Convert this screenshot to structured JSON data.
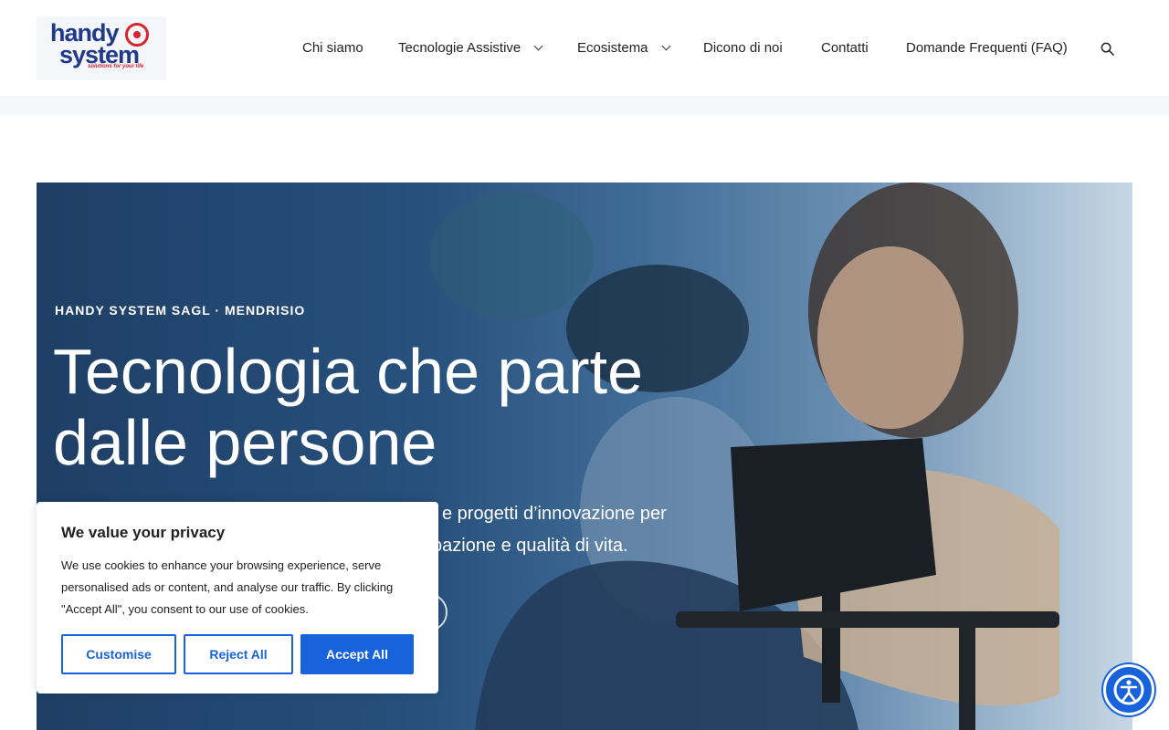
{
  "header": {
    "logo": {
      "line1": "handy",
      "line2": "system",
      "tagline": "solutions for your life"
    },
    "nav": [
      {
        "label": "Chi siamo",
        "has_dropdown": false
      },
      {
        "label": "Tecnologie Assistive",
        "has_dropdown": true
      },
      {
        "label": "Ecosistema",
        "has_dropdown": true
      },
      {
        "label": "Dicono di noi",
        "has_dropdown": false
      },
      {
        "label": "Contatti",
        "has_dropdown": false
      },
      {
        "label": "Domande Frequenti (FAQ)",
        "has_dropdown": false
      }
    ],
    "search_icon": "search-icon"
  },
  "hero": {
    "eyebrow": "HANDY SYSTEM SAGL · MENDRISIO",
    "title": "Tecnologia che parte dalle persone",
    "subtitle_visible": "e progetti d’innovazione per",
    "subtitle_visible_2": "tipazione e qualità di vita."
  },
  "cookie": {
    "title": "We value your privacy",
    "body": "We use cookies to enhance your browsing experience, serve personalised ads or content, and analyse our traffic. By clicking \"Accept All\", you consent to our use of cookies.",
    "customise": "Customise",
    "reject": "Reject All",
    "accept": "Accept All"
  },
  "colors": {
    "accent": "#1863dc",
    "brand_blue": "#1f3a8a",
    "brand_red": "#d9232e",
    "hero_overlay": "#1e3f66"
  },
  "widgets": {
    "accessibility_icon": "accessibility-icon"
  }
}
